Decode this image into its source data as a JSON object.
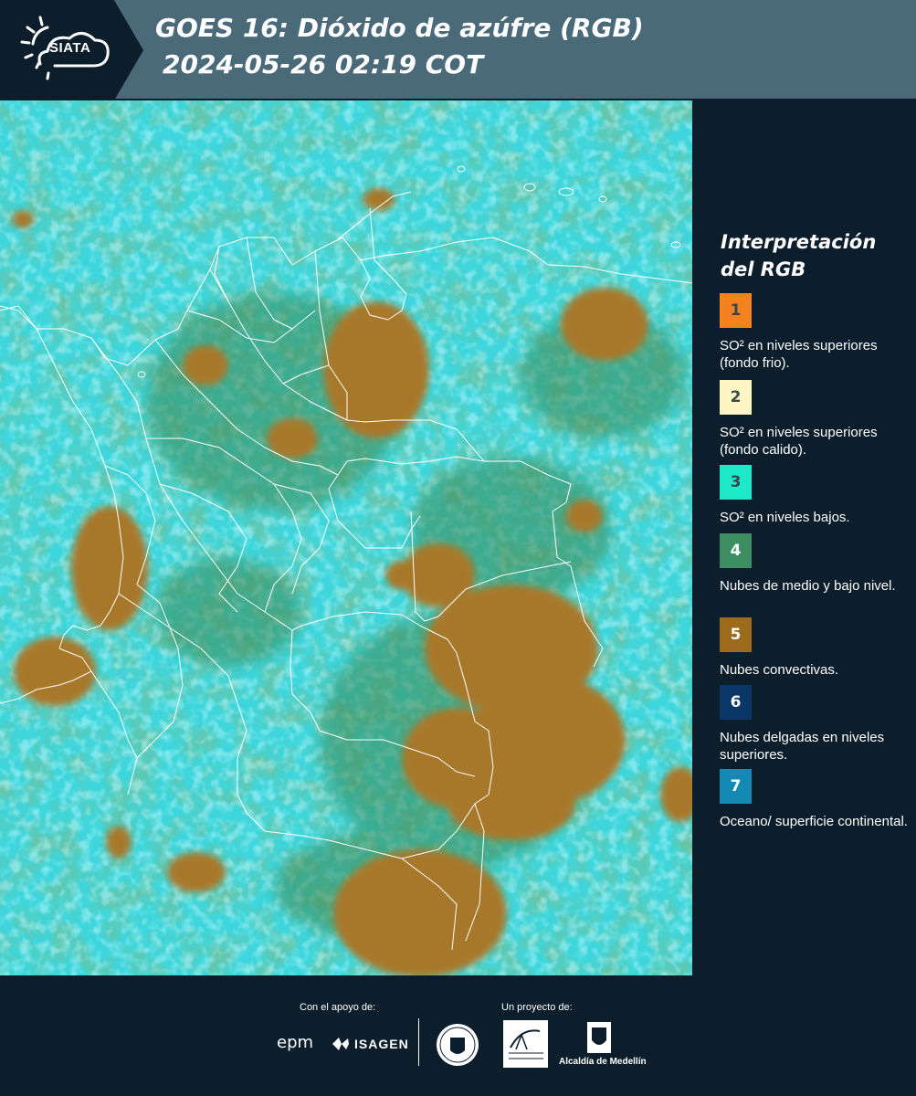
{
  "header": {
    "logo_text": "SIATA",
    "title": "GOES 16: Dióxido de azúfre (RGB)",
    "timestamp": "2024-05-26 02:19 COT"
  },
  "map": {
    "base_color": "#3ed6dc",
    "boundary_color": "#ffffff"
  },
  "legend": {
    "title": "Interpretación del RGB",
    "items": [
      {
        "number": "1",
        "color": "#f5821f",
        "label": "SO² en niveles superiores (fondo frio)."
      },
      {
        "number": "2",
        "color": "#fdf6c3",
        "label": "SO² en niveles superiores (fondo calido)."
      },
      {
        "number": "3",
        "color": "#1de9c8",
        "label": "SO² en niveles bajos."
      },
      {
        "number": "4",
        "color": "#3d8f63",
        "label": "Nubes de medio y bajo nivel."
      },
      {
        "number": "5",
        "color": "#9c6b1c",
        "label": "Nubes convectivas."
      },
      {
        "number": "6",
        "color": "#0b3668",
        "label": "Nubes delgadas en niveles superiores."
      },
      {
        "number": "7",
        "color": "#1489b4",
        "label": "Oceano/ superficie continental."
      }
    ]
  },
  "footer": {
    "support_label": "Con el apoyo de:",
    "project_label": "Un proyecto de:",
    "epm": "epm",
    "isagen": "ISAGEN",
    "alcaldia": "Alcaldía de Medellín"
  }
}
